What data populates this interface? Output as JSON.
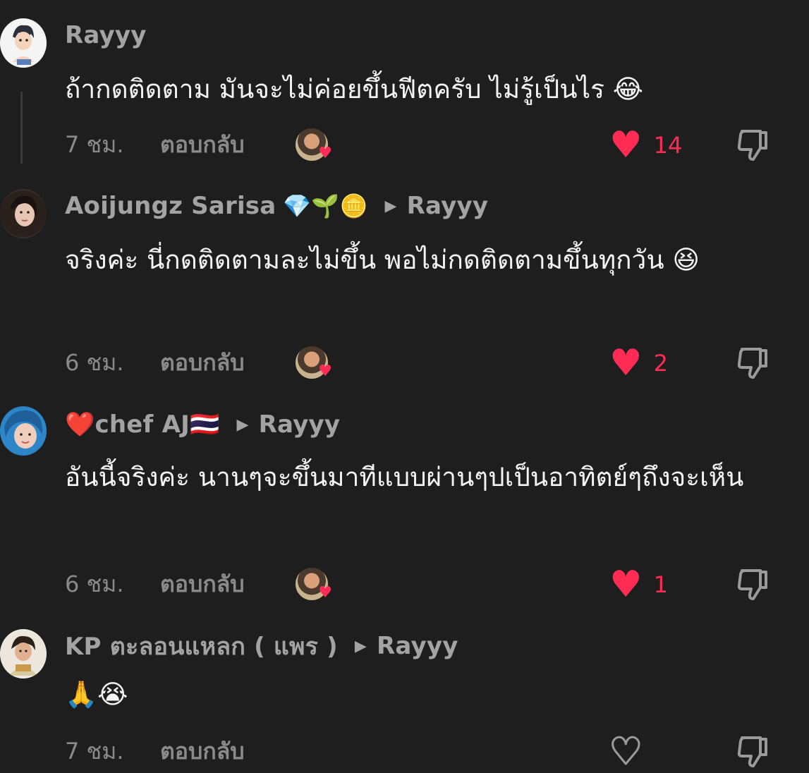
{
  "comments": [
    {
      "name": "Rayyy",
      "badges": "",
      "reply_to": "",
      "text": "ถ้ากดติดตาม มันจะไม่ค่อยขึ้นฟีตครับ ไม่รู้เป็นไร 😂",
      "time": "7 ชม.",
      "reply_label": "ตอบกลับ",
      "likes": "14",
      "liked": true
    },
    {
      "name": "Aoijungz Sarisa",
      "badges": "💎🌱🪙",
      "reply_to": "Rayyy",
      "text": "จริงค่ะ นี่กดติดตามละไม่ขึ้น พอไม่กดติดตามขึ้นทุกวัน 😆",
      "time": "6 ชม.",
      "reply_label": "ตอบกลับ",
      "likes": "2",
      "liked": true
    },
    {
      "name": "❤️chef AJ🇹🇭",
      "badges": "",
      "reply_to": "Rayyy",
      "text": "อันนี้จริงค่ะ นานๆจะขึ้นมาทีแบบผ่านๆปเป็นอาทิตย์ๆถึงจะเห็น",
      "time": "6 ชม.",
      "reply_label": "ตอบกลับ",
      "likes": "1",
      "liked": true
    },
    {
      "name": "KP ตะลอนแหลก ( แพร )",
      "badges": "",
      "reply_to": "Rayyy",
      "text": "🙏😭",
      "time": "7 ชม.",
      "reply_label": "ตอบกลับ",
      "likes": "",
      "liked": false
    }
  ],
  "icons": {
    "heart": "heart-icon",
    "dislike": "thumbs-down-icon",
    "reply_arrow": "triangle-right-icon",
    "creator_liked": "creator-liked-avatar"
  },
  "colors": {
    "background": "#1e1e1e",
    "like": "#fe2c55",
    "secondary_text": "#a3a3a3"
  }
}
